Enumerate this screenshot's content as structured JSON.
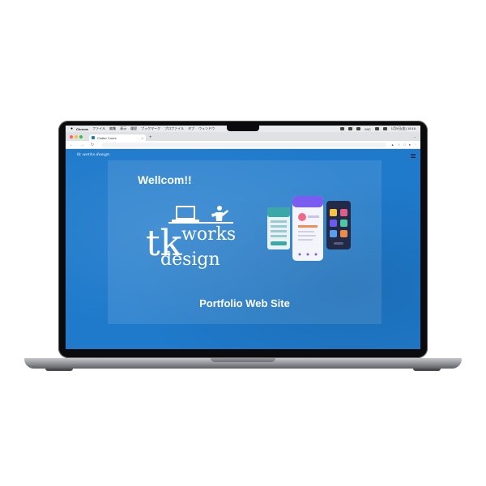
{
  "menubar": {
    "app": "Chrome",
    "items": [
      "ファイル",
      "編集",
      "表示",
      "履歴",
      "ブックマーク",
      "プロファイル",
      "タブ",
      "ウィンドウ"
    ],
    "status_text": "MIC",
    "datetime": "1月5日(金) 15:16"
  },
  "browser": {
    "tab_title": "Clutter Cures",
    "new_tab": "+",
    "tab_close": "×"
  },
  "page": {
    "logo_text": "tk works design",
    "welcome": "Wellcom!!",
    "brand": {
      "line1": "tk",
      "line2": "works",
      "line3": "design"
    },
    "portfolio": "Portfolio Web Site"
  },
  "colors": {
    "page_blue": "#1f7acb",
    "white": "#ffffff"
  }
}
